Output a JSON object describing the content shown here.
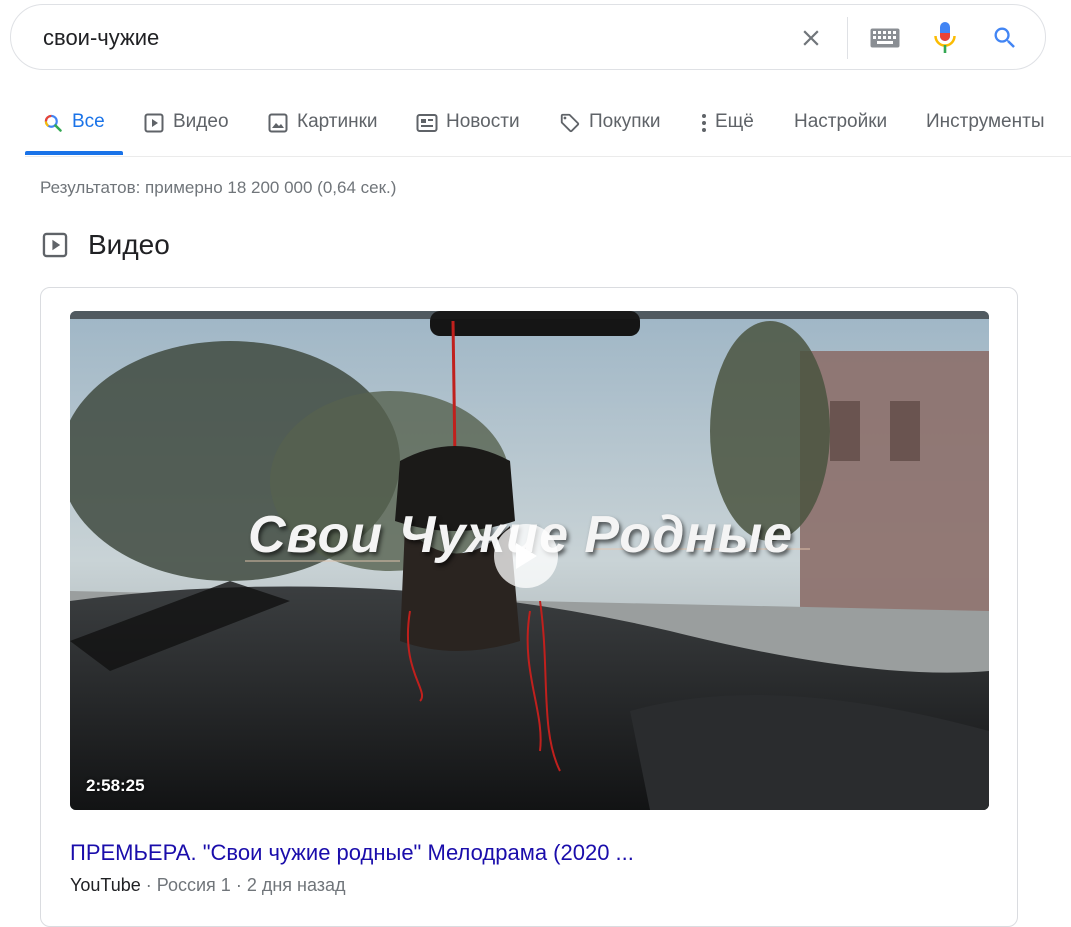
{
  "search": {
    "query": "свои-чужие",
    "icons": {
      "clear": "close-icon",
      "keyboard": "keyboard-icon",
      "mic": "mic-icon",
      "search": "search-icon"
    }
  },
  "tabs": [
    {
      "label": "Все",
      "icon": "search-icon",
      "active": true
    },
    {
      "label": "Видео",
      "icon": "video-play-icon"
    },
    {
      "label": "Картинки",
      "icon": "image-icon"
    },
    {
      "label": "Новости",
      "icon": "news-icon"
    },
    {
      "label": "Покупки",
      "icon": "tag-icon"
    },
    {
      "label": "Ещё",
      "icon": "more-vert-icon"
    },
    {
      "label": "Настройки"
    },
    {
      "label": "Инструменты"
    }
  ],
  "result_stats": "Результатов: примерно 18 200 000 (0,64 сек.)",
  "video_section": {
    "title": "Видео",
    "video": {
      "overlay_text": "Свои Чужие Родные",
      "duration": "2:58:25",
      "title": "ПРЕМЬЕРА. \"Свои чужие родные\" Мелодрама (2020 ...",
      "source": "YouTube",
      "separator": "·",
      "channel": "Россия 1",
      "date": "2 дня назад"
    }
  },
  "colors": {
    "link": "#1a0dab",
    "accent": "#1a73e8",
    "muted": "#70757a"
  }
}
